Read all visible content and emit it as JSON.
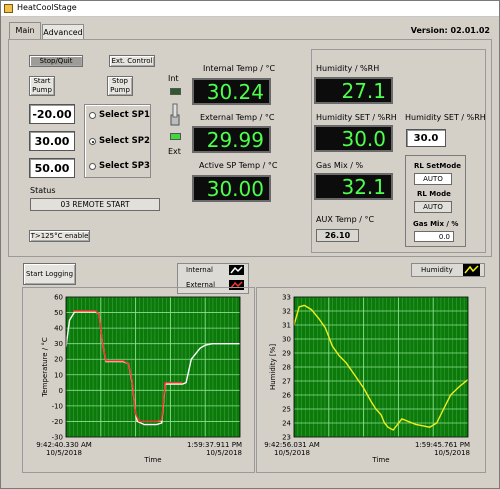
{
  "window": {
    "title": "HeatCoolStage"
  },
  "tabs": [
    {
      "label": "Main",
      "active": true
    },
    {
      "label": "Advanced",
      "active": false
    }
  ],
  "version": "Version: 02.01.02",
  "controls": {
    "stop_quit": "Stop/Quit",
    "ext_control": "Ext. Control",
    "start_pump": "Start\nPump",
    "stop_pump": "Stop\nPump",
    "sp_values": [
      "-20.00",
      "30.00",
      "50.00"
    ],
    "sp_options": [
      "Select SP1",
      "Select SP2",
      "Select SP3"
    ],
    "selected_sp": 1,
    "int_label": "Int",
    "ext_label": "Ext",
    "status_label": "Status",
    "status_value": "03 REMOTE START",
    "t125_button": "T>125°C enable"
  },
  "readouts": {
    "internal_temp_label": "Internal Temp / °C",
    "internal_temp": "30.24",
    "external_temp_label": "External Temp / °C",
    "external_temp": "29.99",
    "active_sp_label": "Active SP Temp / °C",
    "active_sp": "30.00",
    "humidity_label": "Humidity / %RH",
    "humidity": "27.1",
    "humidity_set_label": "Humidity SET / %RH",
    "humidity_set": "30.0",
    "humidity_set_ctrl_label": "Humidity SET / %RH",
    "humidity_set_ctrl": "30.0",
    "gas_mix_label": "Gas Mix / %",
    "gas_mix": "32.1",
    "aux_temp_label": "AUX Temp / °C",
    "aux_temp": "26.10"
  },
  "rl": {
    "setmode_label": "RL SetMode",
    "setmode": "AUTO",
    "mode_label": "RL Mode",
    "mode": "AUTO",
    "gasmix_label": "Gas Mix / %",
    "gasmix": "0.0"
  },
  "logging": {
    "start_logging": "Start Logging"
  },
  "colors": {
    "lcd_text": "#4dff4d",
    "plot_bg": "#0b7a0b",
    "grid": "#8ee08e",
    "internal": "#ffffff",
    "external": "#ff3030",
    "humidity": "#f2ee1c"
  },
  "chart_data": [
    {
      "type": "line",
      "ylabel": "Temperature / °C",
      "xlabel": "Time",
      "ylim": [
        -30,
        60
      ],
      "yticks": [
        "60",
        "50",
        "40",
        "30",
        "20",
        "10",
        "0",
        "-10",
        "-20",
        "-30"
      ],
      "x_start": [
        "9:42:40.330 AM",
        "10/5/2018"
      ],
      "x_end": [
        "1:59:37.911 PM",
        "10/5/2018"
      ],
      "legend": [
        "Internal",
        "External"
      ],
      "series": [
        {
          "name": "Internal",
          "color": "#ffffff",
          "x": [
            0,
            0.02,
            0.05,
            0.17,
            0.19,
            0.21,
            0.23,
            0.33,
            0.36,
            0.38,
            0.4,
            0.41,
            0.45,
            0.52,
            0.55,
            0.57,
            0.67,
            0.69,
            0.72,
            0.77,
            0.8,
            0.84,
            0.9,
            1.0
          ],
          "y": [
            28,
            45,
            50.5,
            50.5,
            49,
            30,
            18.5,
            18.5,
            17,
            5,
            -15,
            -20,
            -22,
            -22,
            -21,
            4,
            4,
            5,
            20,
            27,
            29,
            30,
            30,
            30
          ]
        },
        {
          "name": "External",
          "color": "#ff3030",
          "x": [
            0.04,
            0.17,
            0.19,
            0.21,
            0.23,
            0.33,
            0.36,
            0.38,
            0.4,
            0.42,
            0.52,
            0.55,
            0.57,
            0.67
          ],
          "y": [
            51,
            51,
            49,
            30,
            19,
            19,
            17,
            6,
            -15,
            -20,
            -20,
            -19,
            5,
            5
          ]
        }
      ]
    },
    {
      "type": "line",
      "ylabel": "Humidity [%]",
      "xlabel": "Time",
      "ylim": [
        23,
        33
      ],
      "yticks": [
        "33",
        "32",
        "31",
        "30",
        "29",
        "28",
        "27",
        "26",
        "25",
        "24",
        "23"
      ],
      "x_start": [
        "9:42:56.031 AM",
        "10/5/2018"
      ],
      "x_end": [
        "1:59:45.761 PM",
        "10/5/2018"
      ],
      "legend": [
        "Humidity"
      ],
      "series": [
        {
          "name": "Humidity",
          "color": "#f2ee1c",
          "x": [
            0,
            0.03,
            0.06,
            0.1,
            0.14,
            0.18,
            0.22,
            0.26,
            0.3,
            0.35,
            0.4,
            0.44,
            0.47,
            0.5,
            0.52,
            0.54,
            0.57,
            0.62,
            0.66,
            0.7,
            0.74,
            0.78,
            0.82,
            0.86,
            0.9,
            0.95,
            1.0
          ],
          "y": [
            31.0,
            32.3,
            32.4,
            32.1,
            31.5,
            30.8,
            29.5,
            28.8,
            28.3,
            27.4,
            26.5,
            25.6,
            25.0,
            24.6,
            24.0,
            23.7,
            23.5,
            24.3,
            24.1,
            23.9,
            23.8,
            23.7,
            24.0,
            25.0,
            26.0,
            26.6,
            27.1
          ]
        }
      ]
    }
  ]
}
